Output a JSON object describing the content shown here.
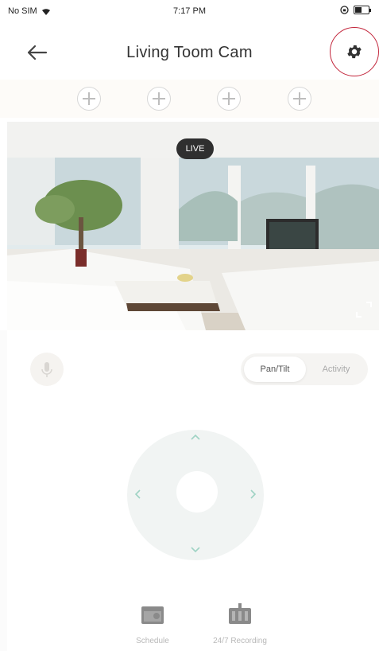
{
  "status_bar": {
    "carrier": "No SIM",
    "time": "7:17 PM"
  },
  "header": {
    "title": "Living Toom Cam",
    "back_icon": "back-arrow-icon",
    "settings_icon": "gear-icon"
  },
  "presets": {
    "count": 4,
    "icon": "plus-icon"
  },
  "video": {
    "badge": "LIVE",
    "fullscreen_icon": "fullscreen-icon"
  },
  "controls": {
    "mic_icon": "microphone-icon",
    "tabs": [
      {
        "label": "Pan/Tilt",
        "active": true
      },
      {
        "label": "Activity",
        "active": false
      }
    ]
  },
  "ptz": {
    "up_icon": "chevron-up-icon",
    "down_icon": "chevron-down-icon",
    "left_icon": "chevron-left-icon",
    "right_icon": "chevron-right-icon"
  },
  "bottom_nav": {
    "items": [
      {
        "label": "Schedule",
        "icon": "schedule-icon"
      },
      {
        "label": "24/7 Recording",
        "icon": "recording-icon"
      }
    ]
  },
  "colors": {
    "highlight_ring": "#c2243a",
    "live_badge": "#2f2f2f",
    "ptz_arrow": "#9fd3c4"
  }
}
